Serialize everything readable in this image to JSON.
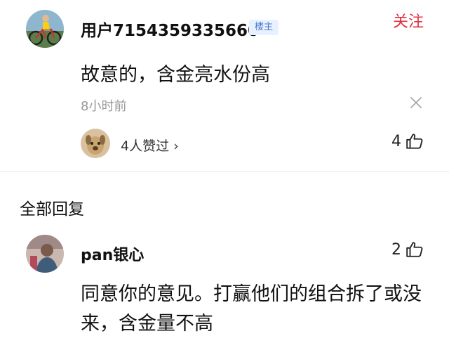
{
  "main_comment": {
    "username": "用户7154359335660",
    "badge": "楼主",
    "follow_label": "关注",
    "content": "故意的，含金亮水份高",
    "timestamp": "8小时前",
    "likes_text": "4人赞过",
    "likes_chevron": "›",
    "like_count": "4"
  },
  "replies_header": "全部回复",
  "replies": [
    {
      "username": "pan银心",
      "like_count": "2",
      "content": "同意你的意见。打赢他们的组合拆了或没来，含金量不高"
    }
  ],
  "colors": {
    "follow": "#e0303f",
    "badge_bg": "#e8f1ff",
    "badge_text": "#4a78c9",
    "muted": "#999999"
  },
  "icons": [
    "cyclist-avatar",
    "close-icon",
    "dog-avatar",
    "chevron-right-icon",
    "thumbs-up-icon",
    "reply-user-avatar"
  ]
}
